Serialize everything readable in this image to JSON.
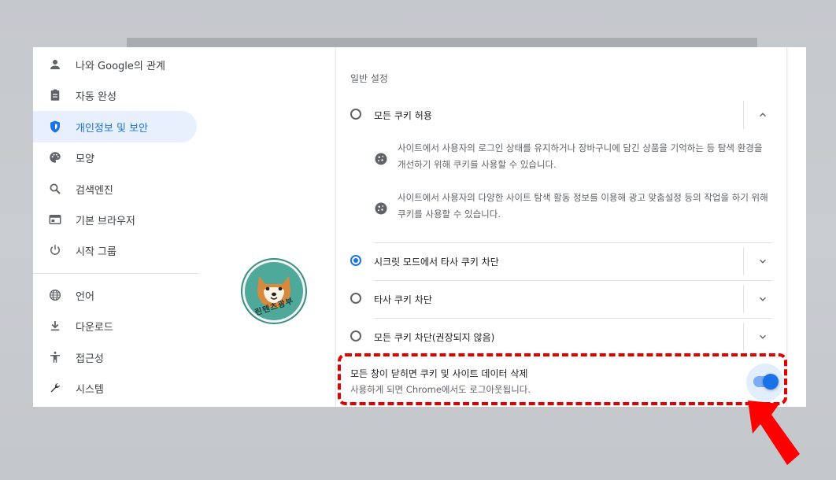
{
  "sidebar": {
    "items": [
      {
        "label": "나와 Google의 관계",
        "icon": "person-icon"
      },
      {
        "label": "자동 완성",
        "icon": "clipboard-icon"
      },
      {
        "label": "개인정보 및 보안",
        "icon": "shield-icon",
        "active": true
      },
      {
        "label": "모양",
        "icon": "palette-icon"
      },
      {
        "label": "검색엔진",
        "icon": "search-icon"
      },
      {
        "label": "기본 브라우저",
        "icon": "browser-icon"
      },
      {
        "label": "시작 그룹",
        "icon": "power-icon"
      },
      {
        "label": "언어",
        "icon": "globe-icon"
      },
      {
        "label": "다운로드",
        "icon": "download-icon"
      },
      {
        "label": "접근성",
        "icon": "accessibility-icon"
      },
      {
        "label": "시스템",
        "icon": "wrench-icon"
      }
    ]
  },
  "main": {
    "section_title": "일반 설정",
    "options": [
      {
        "label": "모든 쿠키 허용",
        "checked": false,
        "expanded": true
      },
      {
        "label": "시크릿 모드에서 타사 쿠키 차단",
        "checked": true,
        "expanded": false
      },
      {
        "label": "타사 쿠키 차단",
        "checked": false,
        "expanded": false
      },
      {
        "label": "모든 쿠키 차단(권장되지 않음)",
        "checked": false,
        "expanded": false
      }
    ],
    "details": [
      {
        "line1": "사이트에서 사용자의 로그인 상태를 유지하거나 장바구니에 담긴 상품을 기억하는 등 탐색 환경을",
        "line2": "개선하기 위해 쿠키를 사용할 수 있습니다."
      },
      {
        "line1": "사이트에서 사용자의 다양한 사이트 탐색 활동 정보를 이용해 광고 맞춤설정 등의 작업을 하기 위해",
        "line2": "쿠키를 사용할 수 있습니다."
      }
    ],
    "toggle": {
      "title": "모든 창이 닫히면 쿠키 및 사이트 데이터 삭제",
      "subtitle": "사용하게 되면 Chrome에서도 로그아웃됩니다.",
      "on": true
    }
  },
  "badge": {
    "text": "린텐츠광부"
  },
  "colors": {
    "accent": "#1a73e8",
    "annotation": "#e00000",
    "active_bg": "#e8f0fe"
  }
}
